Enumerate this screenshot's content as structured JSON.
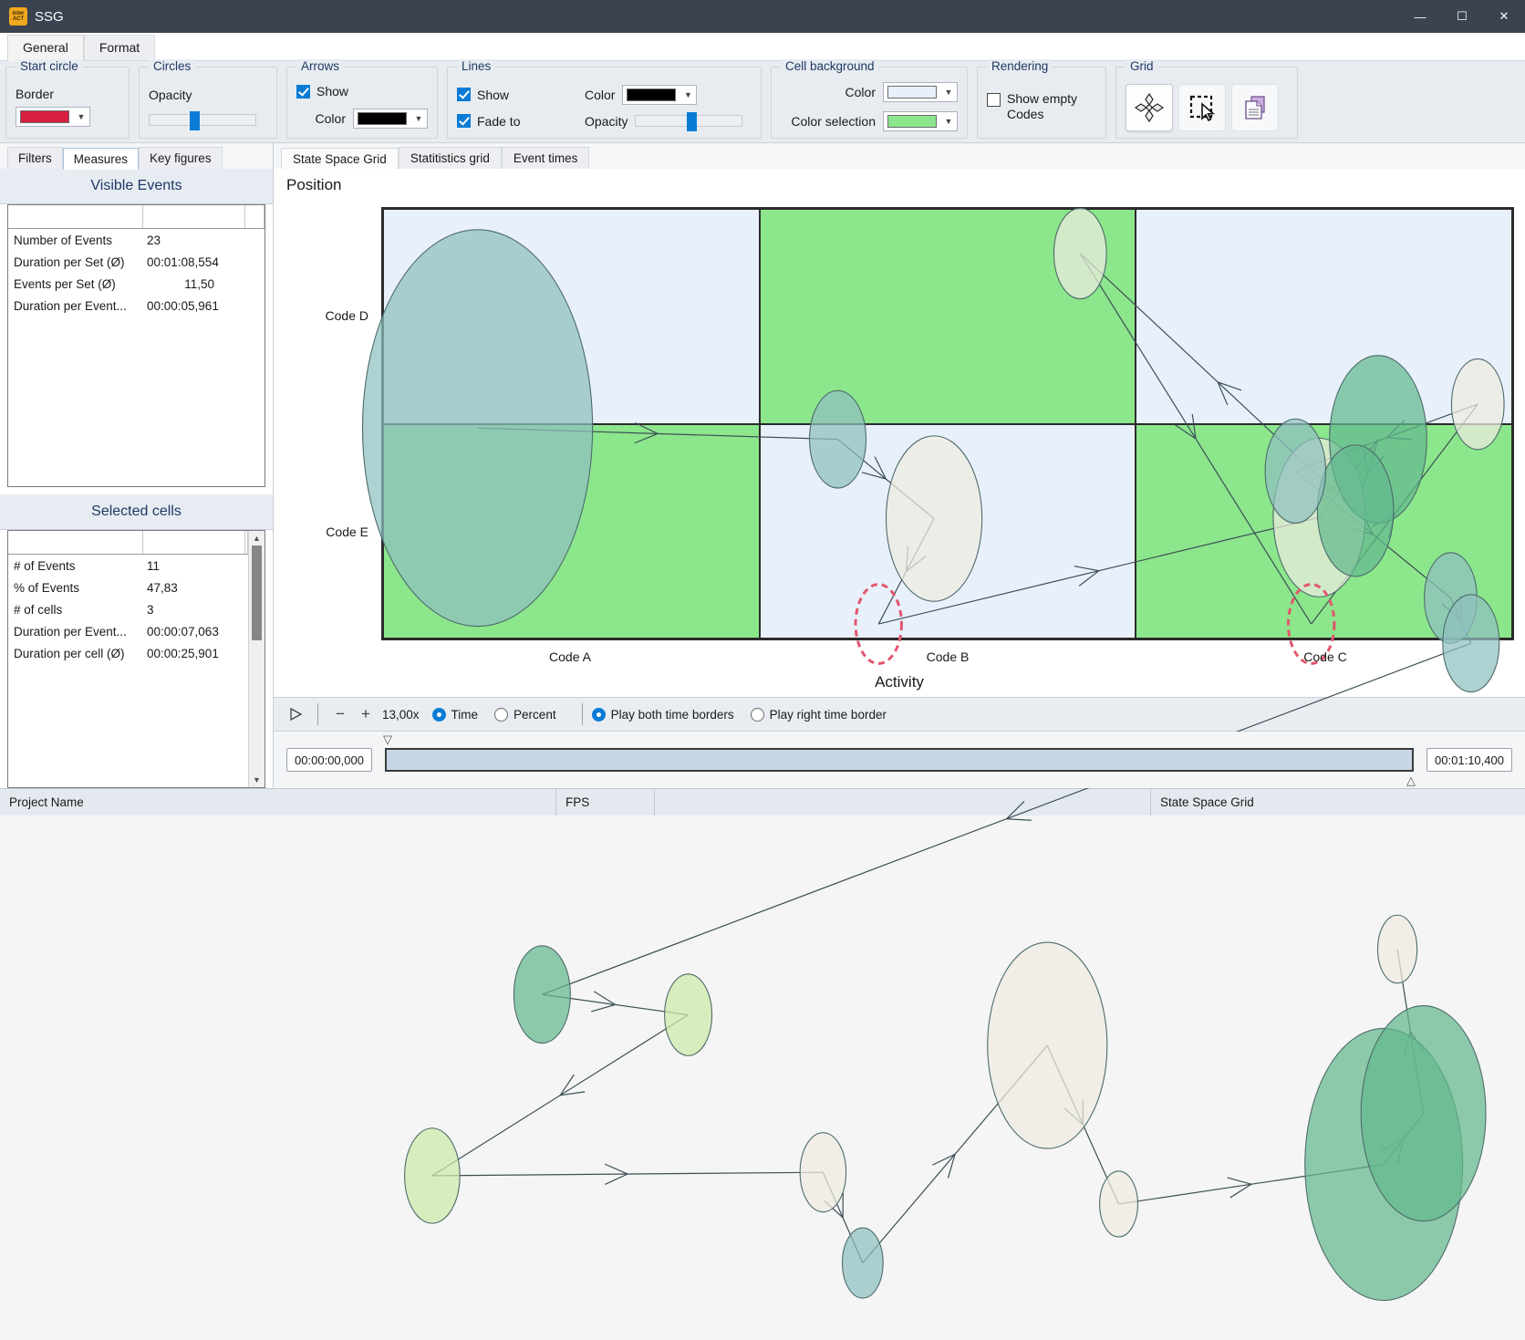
{
  "window": {
    "title": "SSG",
    "logo_text": "inter\nACT",
    "minimize": "—",
    "maximize": "☐",
    "close": "✕"
  },
  "ribbon": {
    "tabs": [
      {
        "label": "General",
        "active": true
      },
      {
        "label": "Format",
        "active": false
      }
    ],
    "groups": {
      "start_circle": {
        "title": "Start circle",
        "border_label": "Border",
        "border_color": "#d81e41"
      },
      "circles": {
        "title": "Circles",
        "opacity_label": "Opacity",
        "opacity_percent": 38
      },
      "arrows": {
        "title": "Arrows",
        "show_label": "Show",
        "show_checked": true,
        "color_label": "Color",
        "color": "#000000"
      },
      "lines": {
        "title": "Lines",
        "show_label": "Show",
        "show_checked": true,
        "fade_label": "Fade to",
        "fade_checked": true,
        "color_label": "Color",
        "color": "#000000",
        "opacity_label": "Opacity",
        "opacity_percent": 48
      },
      "cell_background": {
        "title": "Cell background",
        "color_label": "Color",
        "color": "#e8f0fb",
        "color_selection_label": "Color selection",
        "color_selection": "#8ce68c"
      },
      "rendering": {
        "title": "Rendering",
        "show_empty_label": "Show empty\nCodes",
        "show_empty_line1": "Show empty",
        "show_empty_line2": "Codes",
        "show_empty_checked": false
      },
      "grid": {
        "title": "Grid",
        "buttons": [
          {
            "icon": "diamond-cluster-icon",
            "selected": true
          },
          {
            "icon": "marquee-select-icon",
            "selected": false
          },
          {
            "icon": "copy-document-icon",
            "selected": false
          }
        ]
      }
    }
  },
  "left_panel": {
    "tabs": [
      {
        "label": "Filters",
        "active": false
      },
      {
        "label": "Measures",
        "active": true
      },
      {
        "label": "Key figures",
        "active": false
      }
    ],
    "visible_events": {
      "title": "Visible Events",
      "rows": [
        {
          "label": "Number of Events",
          "value": "23",
          "align": "left"
        },
        {
          "label": "Duration per Set (Ø)",
          "value": "00:01:08,554",
          "align": "left"
        },
        {
          "label": "Events per Set (Ø)",
          "value": "11,50",
          "align": "right"
        },
        {
          "label": "Duration per Event...",
          "value": "00:00:05,961",
          "align": "left"
        }
      ]
    },
    "selected_cells": {
      "title": "Selected cells",
      "rows": [
        {
          "label": "# of Events",
          "value": "11",
          "align": "left"
        },
        {
          "label": "% of Events",
          "value": "47,83",
          "align": "left"
        },
        {
          "label": "# of cells",
          "value": "3",
          "align": "left"
        },
        {
          "label": "Duration per Event...",
          "value": "00:00:07,063",
          "align": "left"
        },
        {
          "label": "Duration per cell (Ø)",
          "value": "00:00:25,901",
          "align": "left"
        }
      ]
    }
  },
  "main": {
    "tabs": [
      {
        "label": "State Space Grid",
        "active": true
      },
      {
        "label": "Statitistics grid",
        "active": false
      },
      {
        "label": "Event times",
        "active": false
      }
    ]
  },
  "chart_data": {
    "type": "scatter",
    "title": "",
    "ylabel": "Position",
    "xlabel": "Activity",
    "xtick_labels": [
      "Code A",
      "Code B",
      "Code C"
    ],
    "ytick_labels": [
      "Code D",
      "Code E"
    ],
    "grid": true,
    "cell_colors": [
      [
        "#e8f0fb",
        "#8ce68c",
        "#e8f0fb"
      ],
      [
        "#8ce68c",
        "#e8f0fb",
        "#8ce68c"
      ]
    ],
    "selected_cells": [
      [
        0,
        1
      ],
      [
        1,
        0
      ],
      [
        1,
        2
      ]
    ],
    "circle_fill_teal": "#8fbfbf",
    "circle_fill_cream": "#efece0",
    "circle_fill_green": "#63b98e",
    "circle_fill_lightgreen": "#cdeaa8",
    "circle_stroke": "#4d6b6b",
    "start_circle_stroke": "#e2566e",
    "line_color": "#3c4f55",
    "nodes": [
      {
        "cx": 0.085,
        "cy": 0.195,
        "r": 0.175,
        "fill": "teal"
      },
      {
        "cx": 0.403,
        "cy": 0.205,
        "r": 0.043,
        "fill": "teal"
      },
      {
        "cx": 0.488,
        "cy": 0.275,
        "r": 0.073,
        "fill": "cream"
      },
      {
        "cx": 0.439,
        "cy": 0.368,
        "r": 0.035,
        "fill": "start"
      },
      {
        "cx": 0.828,
        "cy": 0.274,
        "r": 0.07,
        "fill": "cream"
      },
      {
        "cx": 0.88,
        "cy": 0.205,
        "r": 0.074,
        "fill": "green"
      },
      {
        "cx": 0.86,
        "cy": 0.268,
        "r": 0.058,
        "fill": "green"
      },
      {
        "cx": 0.617,
        "cy": 0.041,
        "r": 0.04,
        "fill": "cream"
      },
      {
        "cx": 0.821,
        "cy": 0.368,
        "r": 0.035,
        "fill": "start"
      },
      {
        "cx": 0.968,
        "cy": 0.174,
        "r": 0.04,
        "fill": "cream"
      },
      {
        "cx": 0.807,
        "cy": 0.233,
        "r": 0.046,
        "fill": "teal"
      },
      {
        "cx": 0.944,
        "cy": 0.345,
        "r": 0.04,
        "fill": "teal"
      },
      {
        "cx": 0.962,
        "cy": 0.385,
        "r": 0.043,
        "fill": "teal"
      },
      {
        "cx": 0.142,
        "cy": 0.695,
        "r": 0.043,
        "fill": "green"
      },
      {
        "cx": 0.271,
        "cy": 0.713,
        "r": 0.036,
        "fill": "lightgreen"
      },
      {
        "cx": 0.045,
        "cy": 0.855,
        "r": 0.042,
        "fill": "lightgreen"
      },
      {
        "cx": 0.39,
        "cy": 0.852,
        "r": 0.035,
        "fill": "cream"
      },
      {
        "cx": 0.425,
        "cy": 0.932,
        "r": 0.031,
        "fill": "teal"
      },
      {
        "cx": 0.588,
        "cy": 0.74,
        "r": 0.091,
        "fill": "cream"
      },
      {
        "cx": 0.651,
        "cy": 0.88,
        "r": 0.029,
        "fill": "cream"
      },
      {
        "cx": 0.885,
        "cy": 0.845,
        "r": 0.12,
        "fill": "green"
      },
      {
        "cx": 0.92,
        "cy": 0.8,
        "r": 0.095,
        "fill": "green"
      },
      {
        "cx": 0.897,
        "cy": 0.655,
        "r": 0.03,
        "fill": "cream"
      }
    ]
  },
  "playback": {
    "play_icon": "play-icon",
    "minus_label": "−",
    "plus_label": "+",
    "speed": "13,00x",
    "mode_options": [
      {
        "label": "Time",
        "selected": true
      },
      {
        "label": "Percent",
        "selected": false
      }
    ],
    "border_options": [
      {
        "label": "Play both time borders",
        "selected": true
      },
      {
        "label": "Play right time border",
        "selected": false
      }
    ],
    "start_time": "00:00:00,000",
    "end_time": "00:01:10,400"
  },
  "statusbar": {
    "project_name": "Project Name",
    "fps_label": "FPS",
    "fps_value": "",
    "view_name": "State Space Grid"
  }
}
